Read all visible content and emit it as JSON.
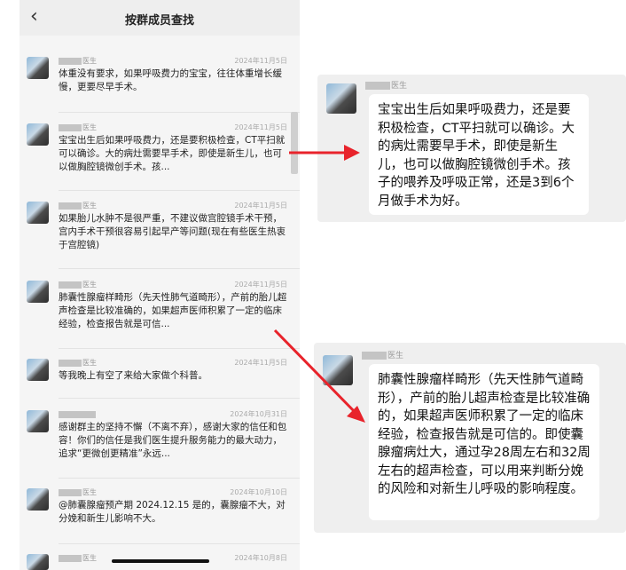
{
  "header": {
    "title": "按群成员查找",
    "back_icon": "‹"
  },
  "messages": [
    {
      "name": "医生",
      "date": "2024年11月5日",
      "text": "体重没有要求，如果呼吸费力的宝宝，往往体重增长缓慢，更要尽早手术。"
    },
    {
      "name": "医生",
      "date": "2024年11月5日",
      "text": "宝宝出生后如果呼吸费力，还是要积极检查，CT平扫就可以确诊。大的病灶需要早手术，即使是新生儿，也可以做胸腔镜微创手术。孩..."
    },
    {
      "name": "医生",
      "date": "2024年11月5日",
      "text": "如果胎儿水肿不是很严重，不建议做宫腔镜手术干预，宫内手术干预很容易引起早产等问题(现在有些医生热衷于宫腔镜)"
    },
    {
      "name": "医生",
      "date": "2024年11月5日",
      "text": "肺囊性腺瘤样畸形（先天性肺气道畸形），产前的胎儿超声检查是比较准确的，如果超声医师积累了一定的临床经验，检查报告就是可信..."
    },
    {
      "name": "医生",
      "date": "2024年11月5日",
      "text": "等我晚上有空了来给大家做个科普。"
    },
    {
      "name": "",
      "date": "2024年10月31日",
      "text": "感谢群主的坚持不懈（不离不弃），感谢大家的信任和包容！你们的信任是我们医生提升服务能力的最大动力，追求“更微创更精准”永远..."
    },
    {
      "name": "医生",
      "date": "2024年10月10日",
      "text": "@肺囊腺瘤预产期 2024.12.15 是的，囊腺瘤不大，对分娩和新生儿影响不大。"
    },
    {
      "name": "医生",
      "date": "2024年10月8日",
      "text": ""
    }
  ],
  "cards": [
    {
      "name": "医生",
      "text": "宝宝出生后如果呼吸费力，还是要积极检查，CT平扫就可以确诊。大的病灶需要早手术，即使是新生儿，也可以做胸腔镜微创手术。孩子的喂养及呼吸正常，还是3到6个月做手术为好。"
    },
    {
      "name": "医生",
      "text": "肺囊性腺瘤样畸形（先天性肺气道畸形），产前的胎儿超声检查是比较准确的，如果超声医师积累了一定的临床经验，检查报告就是可信的。即使囊腺瘤病灶大，通过孕28周左右和32周左右的超声检查，可以用来判断分娩的风险和对新生儿呼吸的影响程度。"
    }
  ],
  "colors": {
    "arrow": "#e8232b",
    "panel_bg": "#f5f5f5",
    "card_bg": "#efefef"
  }
}
